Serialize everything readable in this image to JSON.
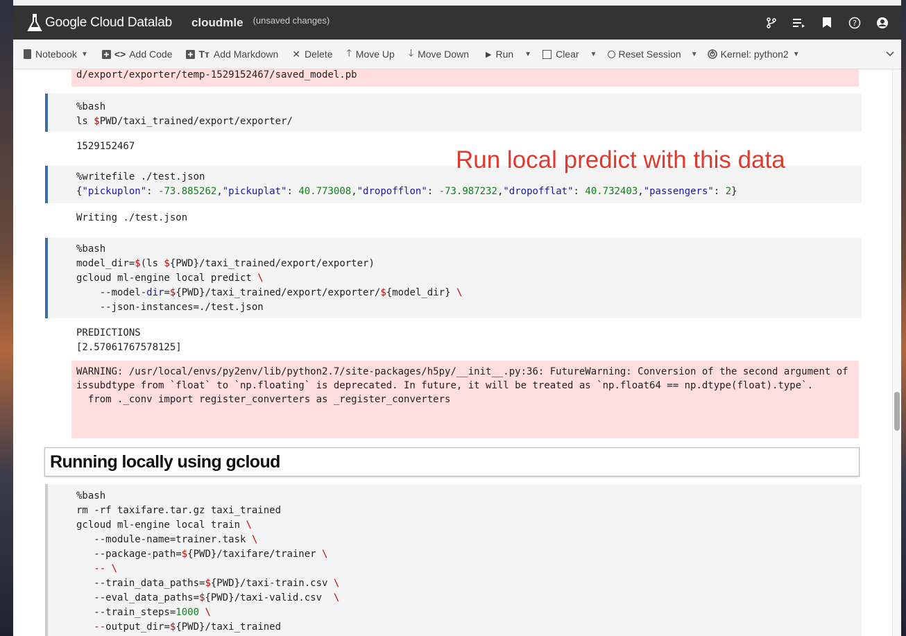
{
  "app": {
    "title": "Google Cloud Datalab",
    "notebook_name": "cloudmle",
    "status": "(unsaved changes)"
  },
  "header_icons": [
    "branch-icon",
    "playlist-icon",
    "bookmark-icon",
    "help-icon",
    "account-icon"
  ],
  "toolbar": {
    "notebook": "Notebook",
    "add_code": "Add Code",
    "add_markdown": "Add Markdown",
    "delete": "Delete",
    "move_up": "Move Up",
    "move_down": "Move Down",
    "run": "Run",
    "clear": "Clear",
    "reset_session": "Reset Session",
    "kernel": "Kernel: python2"
  },
  "cells": {
    "err_top": "d/export/exporter/temp-1529152467/saved_model.pb",
    "ls_cell": [
      "%bash",
      "ls $PWD/taxi_trained/export/exporter/"
    ],
    "ls_output": "1529152467",
    "writefile_cell": {
      "line1": "%writefile ./test.json",
      "json_line": "{\"pickuplon\": -73.885262,\"pickuplat\": 40.773008,\"dropofflon\": -73.987232,\"dropofflat\": 40.732403,\"passengers\": 2}"
    },
    "writefile_output": "Writing ./test.json",
    "predict_cell": [
      "%bash",
      "model_dir=$(ls ${PWD}/taxi_trained/export/exporter)",
      "gcloud ml-engine local predict \\",
      "    --model-dir=${PWD}/taxi_trained/export/exporter/${model_dir} \\",
      "    --json-instances=./test.json"
    ],
    "predict_output": [
      "PREDICTIONS",
      "[2.57061767578125]"
    ],
    "warning": "WARNING: /usr/local/envs/py2env/lib/python2.7/site-packages/h5py/__init__.py:36: FutureWarning: Conversion of the second argument of issubdtype from `float` to `np.floating` is deprecated. In future, it will be treated as `np.float64 == np.dtype(float).type`.\n  from ._conv import register_converters as _register_converters",
    "markdown_heading": "Running locally using gcloud",
    "train_cell": [
      "%bash",
      "rm -rf taxifare.tar.gz taxi_trained",
      "gcloud ml-engine local train \\",
      "   --module-name=trainer.task \\",
      "   --package-path=${PWD}/taxifare/trainer \\",
      "   -- \\",
      "   --train_data_paths=${PWD}/taxi-train.csv \\",
      "   --eval_data_paths=${PWD}/taxi-valid.csv  \\",
      "   --train_steps=1000 \\",
      "   --output_dir=${PWD}/taxi_trained"
    ]
  },
  "annotation": "Run local predict with this data"
}
